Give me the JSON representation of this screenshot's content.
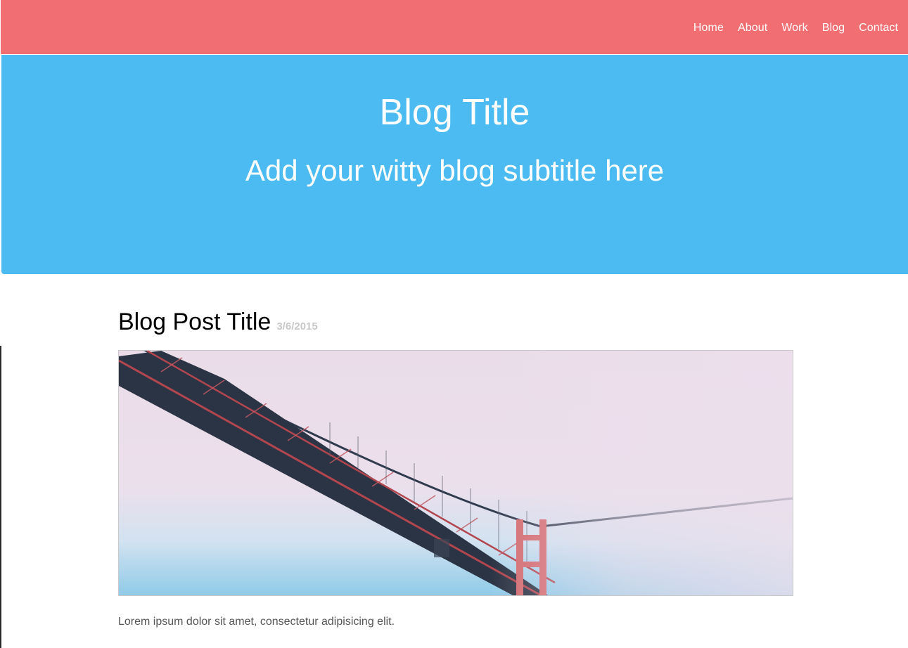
{
  "nav": {
    "items": [
      {
        "label": "Home"
      },
      {
        "label": "About"
      },
      {
        "label": "Work"
      },
      {
        "label": "Blog"
      },
      {
        "label": "Contact"
      }
    ]
  },
  "hero": {
    "title": "Blog Title",
    "subtitle": "Add your witty blog subtitle here"
  },
  "post": {
    "title": "Blog Post Title",
    "date": "3/6/2015",
    "image_subject": "suspension bridge in fog",
    "excerpt": "Lorem ipsum dolor sit amet, consectetur adipisicing elit."
  },
  "colors": {
    "nav_bg": "#f16e73",
    "hero_bg": "#4bbbf1",
    "text_white": "#ffffff",
    "date_gray": "#c8c8c8",
    "excerpt_gray": "#555555"
  }
}
